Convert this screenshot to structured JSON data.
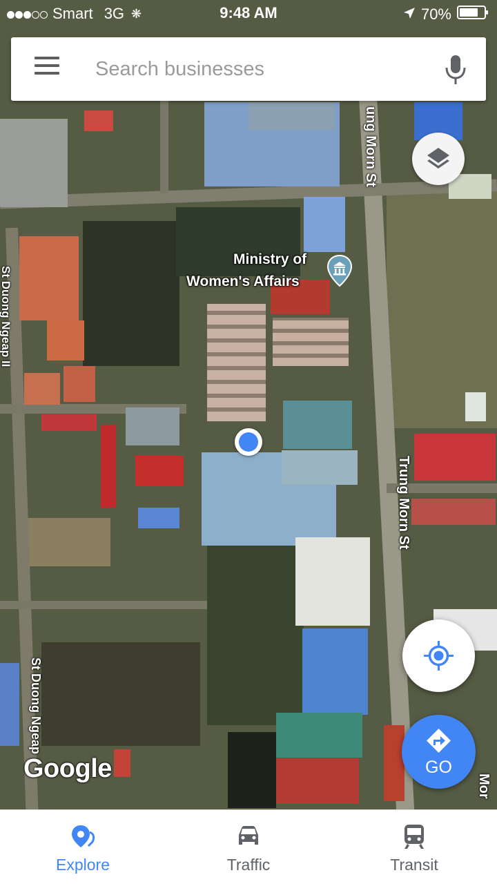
{
  "status_bar": {
    "carrier": "Smart",
    "network": "3G",
    "time": "9:48 AM",
    "battery": "70%",
    "signal_bars_filled": 3,
    "signal_bars_total": 5
  },
  "search": {
    "placeholder": "Search businesses",
    "value": ""
  },
  "map": {
    "place_label_line1": "Ministry of",
    "place_label_line2": "Women's Affairs",
    "place_icon": "museum-icon",
    "street_trung_morn_top": "ung Morn St",
    "street_trung_morn_mid": "Trung Morn St",
    "street_trung_morn_bottom": "Mor",
    "street_duong_ngeap_top": "St Duong Ngeap II",
    "street_duong_ngeap_bottom": "St Duong Ngeap",
    "attribution": "Google"
  },
  "buttons": {
    "go_label": "GO",
    "layers_icon": "layers-icon",
    "my_location_icon": "my-location-icon"
  },
  "bottom_nav": {
    "items": [
      {
        "label": "Explore",
        "icon": "explore-pin-icon",
        "active": true
      },
      {
        "label": "Traffic",
        "icon": "car-icon",
        "active": false
      },
      {
        "label": "Transit",
        "icon": "train-icon",
        "active": false
      }
    ]
  },
  "colors": {
    "accent": "#4285f4",
    "inactive": "#5f6368",
    "location_dot": "#4285f4"
  }
}
